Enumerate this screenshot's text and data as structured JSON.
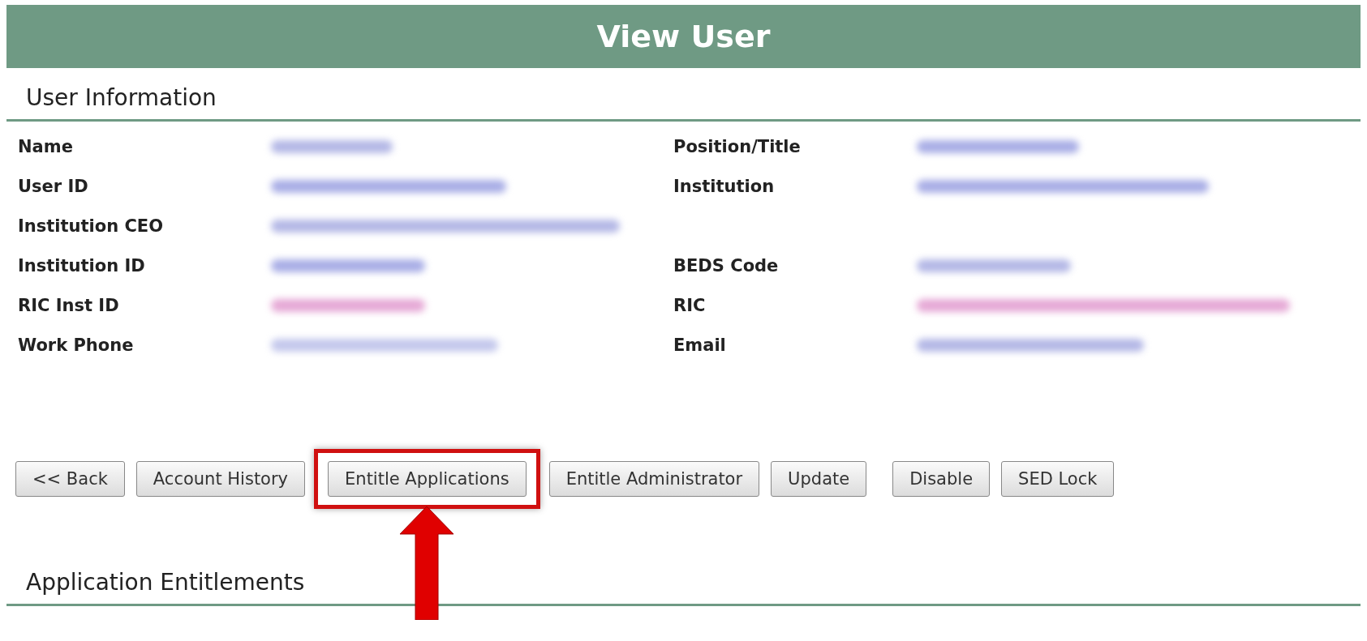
{
  "header": {
    "title": "View User"
  },
  "user_information": {
    "title": "User Information",
    "rows": [
      {
        "left": {
          "label": "Name",
          "color": "#b4b8e6"
        },
        "right": {
          "label": "Position/Title",
          "color": "#a9aee6"
        }
      },
      {
        "left": {
          "label": "User ID",
          "color": "#a9aee6"
        },
        "right": {
          "label": "Institution",
          "color": "#a9aee6"
        }
      },
      {
        "left": {
          "label": "Institution CEO",
          "color": "#b4b8e6"
        }
      },
      {
        "left": {
          "label": "Institution ID",
          "color": "#a9aee6"
        },
        "right": {
          "label": "BEDS Code",
          "color": "#b4b8e6"
        }
      },
      {
        "left": {
          "label": "RIC Inst ID",
          "color": "#e6a9d6"
        },
        "right": {
          "label": "RIC",
          "color": "#e6a9d6"
        }
      },
      {
        "left": {
          "label": "Work Phone",
          "color": "#c4c8ec"
        },
        "right": {
          "label": "Email",
          "color": "#b4b8e6"
        }
      }
    ]
  },
  "buttons": [
    {
      "label": "<< Back",
      "highlighted": false
    },
    {
      "label": "Account History",
      "highlighted": false
    },
    {
      "label": "Entitle Applications",
      "highlighted": true
    },
    {
      "label": "Entitle Administrator",
      "highlighted": false
    },
    {
      "label": "Update",
      "highlighted": false
    },
    {
      "label": "Disable",
      "highlighted": false
    },
    {
      "label": "SED Lock",
      "highlighted": false
    }
  ],
  "application_entitlements": {
    "title": "Application Entitlements"
  }
}
